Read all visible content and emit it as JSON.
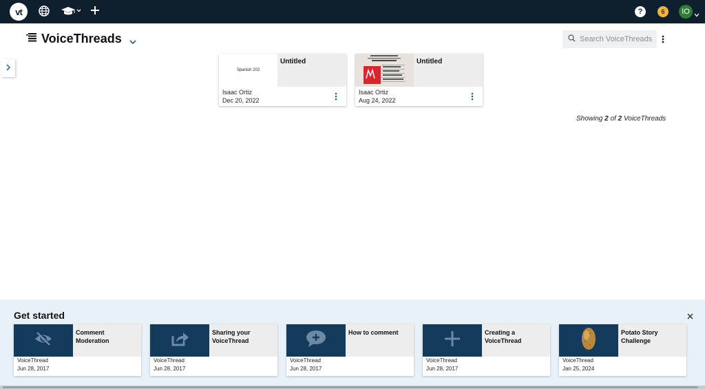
{
  "topbar": {
    "logo_text": "vt",
    "icons": [
      "globe-icon",
      "graduation-cap-icon",
      "plus-icon"
    ],
    "help_label": "?",
    "notification_count": "6",
    "avatar_initials": "IO",
    "colors": {
      "bar": "#0f1f2e",
      "notification": "#f0b43c",
      "avatar": "#2e7d32"
    }
  },
  "header": {
    "title": "VoiceThreads",
    "search_placeholder": "Search VoiceThreads"
  },
  "threads": [
    {
      "title": "Untitled",
      "author": "Isaac Ortiz",
      "date": "Dec 20, 2022",
      "thumb_text": "Spanish 202"
    },
    {
      "title": "Untitled",
      "author": "Isaac Ortiz",
      "date": "Aug 24, 2022",
      "thumb_text": ""
    }
  ],
  "showing": {
    "prefix": "Showing",
    "shown": "2",
    "of": "of",
    "total": "2",
    "suffix": "VoiceThreads"
  },
  "get_started": {
    "title": "Get started",
    "close_label": "×",
    "cards": [
      {
        "label": "Comment Moderation",
        "author": "VoiceThread",
        "date": "Jun 28, 2017",
        "icon": "eye-slash-icon"
      },
      {
        "label": "Sharing your VoiceThread",
        "author": "VoiceThread",
        "date": "Jun 28, 2017",
        "icon": "share-icon"
      },
      {
        "label": "How to comment",
        "author": "VoiceThread",
        "date": "Jun 28, 2017",
        "icon": "comment-plus-icon"
      },
      {
        "label": "Creating a VoiceThread",
        "author": "VoiceThread",
        "date": "Jun 28, 2017",
        "icon": "plus-icon"
      },
      {
        "label": "Potato Story Challenge",
        "author": "VoiceThread",
        "date": "Jan 25, 2024",
        "icon": "potato-icon"
      }
    ]
  }
}
